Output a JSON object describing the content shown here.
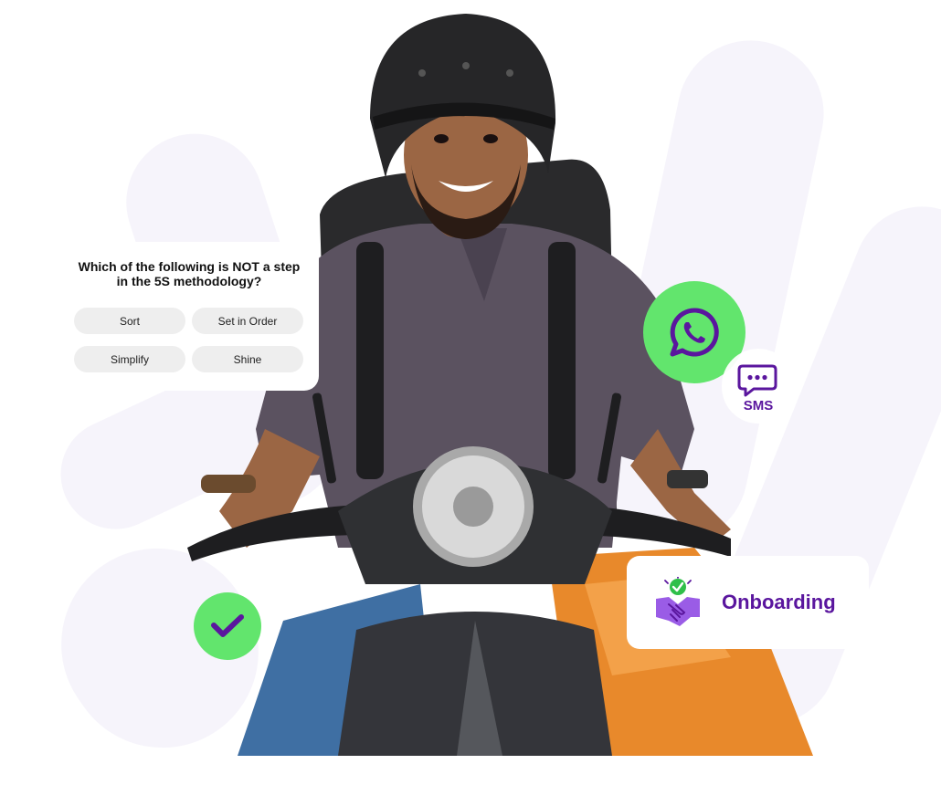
{
  "quiz": {
    "question": "Which of the following is NOT a step in the 5S methodology?",
    "options": [
      "Sort",
      "Set in Order",
      "Simplify",
      "Shine"
    ]
  },
  "channels": {
    "whatsapp_icon": "whatsapp-icon",
    "sms_icon": "chat-bubble-icon",
    "sms_label": "SMS"
  },
  "status": {
    "check_icon": "checkmark-icon"
  },
  "onboarding": {
    "icon": "handshake-icon",
    "label": "Onboarding"
  },
  "colors": {
    "accent_green": "#62e56d",
    "brand_purple": "#5a169e",
    "icon_purple": "#9a5ce6",
    "option_bg": "#eeeeee"
  }
}
